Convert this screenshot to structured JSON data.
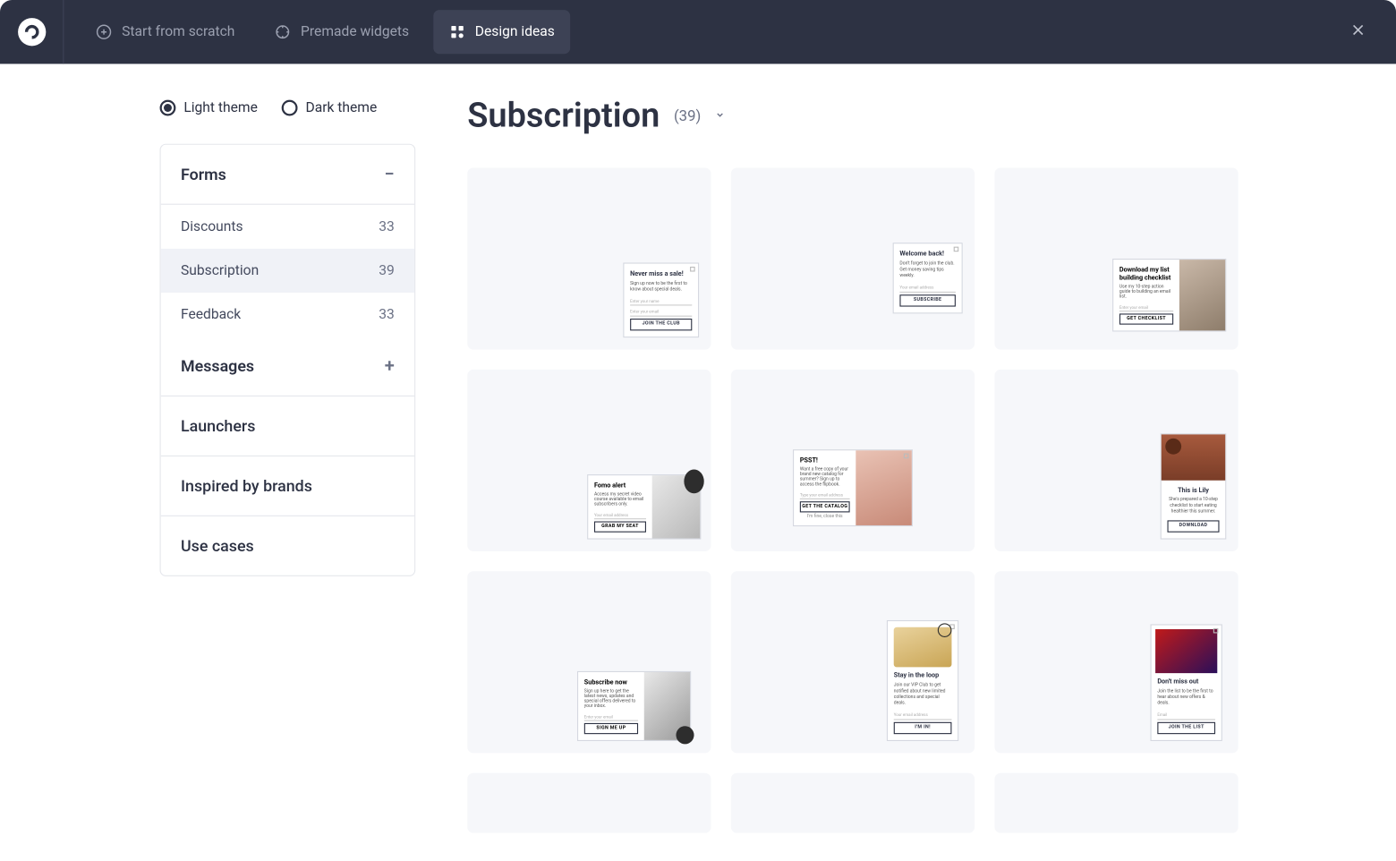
{
  "topbar": {
    "tabs": [
      {
        "label": "Start from scratch"
      },
      {
        "label": "Premade widgets"
      },
      {
        "label": "Design ideas"
      }
    ]
  },
  "theme": {
    "light": "Light theme",
    "dark": "Dark theme"
  },
  "sidebar": {
    "forms": {
      "label": "Forms"
    },
    "items": [
      {
        "label": "Discounts",
        "count": "33"
      },
      {
        "label": "Subscription",
        "count": "39"
      },
      {
        "label": "Feedback",
        "count": "33"
      }
    ],
    "messages": {
      "label": "Messages"
    },
    "launchers": {
      "label": "Launchers"
    },
    "inspired": {
      "label": "Inspired by brands"
    },
    "usecases": {
      "label": "Use cases"
    }
  },
  "heading": {
    "title": "Subscription",
    "count": "(39)"
  },
  "cards": {
    "c1": {
      "title": "Never miss a sale!",
      "sub": "Sign up now to be the first to know about special deals.",
      "f1": "Enter your name",
      "f2": "Enter your email",
      "cta": "JOIN THE CLUB"
    },
    "c2": {
      "title": "Welcome back!",
      "sub": "Don't forget to join the club. Get money saving tips weekly.",
      "f1": "Your email address",
      "cta": "SUBSCRIBE"
    },
    "c3": {
      "title": "Download my list building checklist",
      "sub": "Use my 10-step action guide to building an email list.",
      "f1": "Enter your email",
      "cta": "GET CHECKLIST"
    },
    "c4": {
      "title": "Fomo alert",
      "sub": "Access my secret video course available to email subscribers only.",
      "f1": "Your email address",
      "cta": "GRAB MY SEAT"
    },
    "c5": {
      "title": "PSST!",
      "sub": "Want a free copy of your brand new catalog for summer? Sign up to access the flipbook.",
      "f1": "Type your email address",
      "cta": "GET THE CATALOG",
      "secondary": "I'm fine, close this"
    },
    "c6": {
      "title": "This is Lily",
      "sub": "She's prepared a 10-step checklist to start eating healthier this summer.",
      "cta": "DOWNLOAD"
    },
    "c7": {
      "title": "Subscribe now",
      "sub": "Sign up here to get the latest news, updates and special offers delivered to your inbox.",
      "f1": "Enter your email",
      "cta": "SIGN ME UP"
    },
    "c8": {
      "title": "Stay in the loop",
      "sub": "Join our VIP Club to get notified about new limited collections and special deals.",
      "f1": "Your email address",
      "cta": "I'M IN!"
    },
    "c9": {
      "title": "Don't miss out",
      "sub": "Join the list to be the first to hear about new offers & deals.",
      "f1": "Email",
      "cta": "JOIN THE LIST"
    }
  }
}
